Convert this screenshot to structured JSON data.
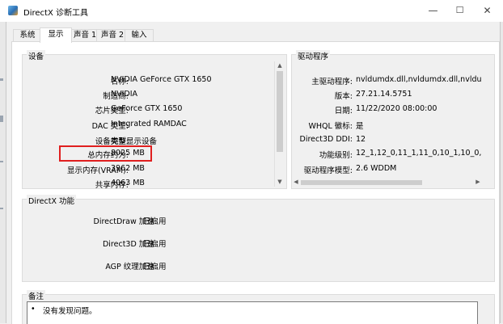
{
  "window": {
    "title": "DirectX 诊断工具",
    "minimize_glyph": "—",
    "maximize_glyph": "☐",
    "close_glyph": "✕"
  },
  "tabs": [
    {
      "label": "系统",
      "active": false
    },
    {
      "label": "显示",
      "active": true
    },
    {
      "label": "声音 1",
      "active": false
    },
    {
      "label": "声音 2",
      "active": false
    },
    {
      "label": "输入",
      "active": false
    }
  ],
  "device": {
    "title": "设备",
    "rows": [
      {
        "label": "名称:",
        "value": "NVIDIA GeForce GTX 1650"
      },
      {
        "label": "制造商:",
        "value": "NVIDIA"
      },
      {
        "label": "芯片类型:",
        "value": "GeForce GTX 1650"
      },
      {
        "label": "DAC 类型:",
        "value": "Integrated RAMDAC"
      },
      {
        "label": "设备类型:",
        "value": "完整显示设备"
      },
      {
        "label": "总内存约为:",
        "value": "8025 MB"
      },
      {
        "label": "显示内存(VRAM):",
        "value": "3962 MB"
      },
      {
        "label": "共享内存:",
        "value": "4063 MB"
      }
    ]
  },
  "driver": {
    "title": "驱动程序",
    "rows": [
      {
        "label": "主驱动程序:",
        "value": "nvldumdx.dll,nvldumdx.dll,nvldumdx.d"
      },
      {
        "label": "版本:",
        "value": "27.21.14.5751"
      },
      {
        "label": "日期:",
        "value": "11/22/2020 08:00:00"
      },
      {
        "label": "WHQL 徽标:",
        "value": "是"
      },
      {
        "label": "Direct3D DDI:",
        "value": "12"
      },
      {
        "label": "功能级别:",
        "value": "12_1,12_0,11_1,11_0,10_1,10_0,9_3,9_2"
      },
      {
        "label": "驱动程序模型:",
        "value": "2.6 WDDM"
      }
    ]
  },
  "features": {
    "title": "DirectX 功能",
    "rows": [
      {
        "label": "DirectDraw 加速:",
        "value": "已启用"
      },
      {
        "label": "Direct3D 加速:",
        "value": "已启用"
      },
      {
        "label": "AGP 纹理加速:",
        "value": "已启用"
      }
    ]
  },
  "notes": {
    "title": "备注",
    "items": [
      "没有发现问题。"
    ]
  },
  "colors": {
    "highlight": "#e01f1f"
  }
}
